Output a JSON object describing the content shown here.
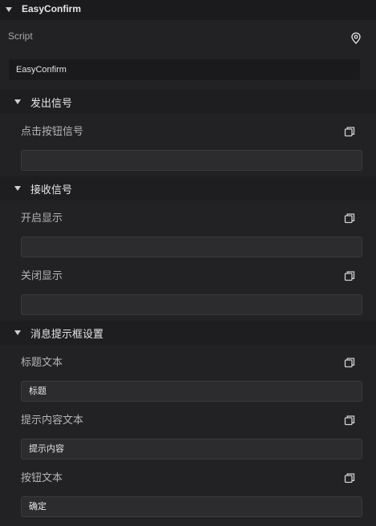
{
  "header": {
    "title": "EasyConfirm"
  },
  "script": {
    "label": "Script",
    "value": "EasyConfirm"
  },
  "sections": [
    {
      "title": "发出信号",
      "fields": [
        {
          "label": "点击按钮信号",
          "value": ""
        }
      ]
    },
    {
      "title": "接收信号",
      "fields": [
        {
          "label": "开启显示",
          "value": ""
        },
        {
          "label": "关闭显示",
          "value": ""
        }
      ]
    },
    {
      "title": "消息提示框设置",
      "fields": [
        {
          "label": "标题文本",
          "value": "标题"
        },
        {
          "label": "提示内容文本",
          "value": "提示内容"
        },
        {
          "label": "按钮文本",
          "value": "确定"
        }
      ]
    }
  ],
  "icons": {
    "script": "map-pin-icon",
    "field_action": "copy-icon"
  }
}
